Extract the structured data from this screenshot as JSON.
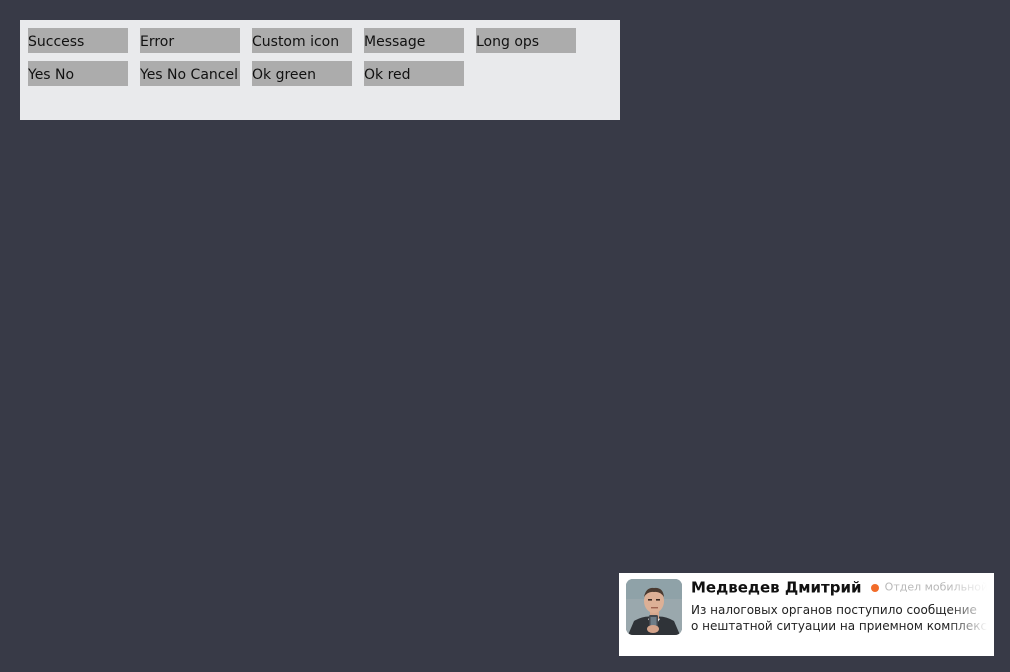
{
  "demo_buttons": {
    "row1": {
      "success": "Success",
      "error": "Error",
      "custom_icon": "Custom icon",
      "message": "Message",
      "long_ops": "Long ops"
    },
    "row2": {
      "yes_no": "Yes No",
      "yes_no_cancel": "Yes No Cancel",
      "ok_green": "Ok green",
      "ok_red": "Ok red"
    }
  },
  "notification": {
    "sender_name": "Медведев Дмитрий",
    "department": "Отдел мобильной разработки",
    "message_line1": "Из налоговых органов поступило сообщение",
    "message_line2": "о нештатной ситуации на приемном комплексе",
    "status_color": "#f26c2a"
  },
  "colors": {
    "background": "#383a47",
    "panel": "#e9eaec",
    "button": "#acacac"
  }
}
